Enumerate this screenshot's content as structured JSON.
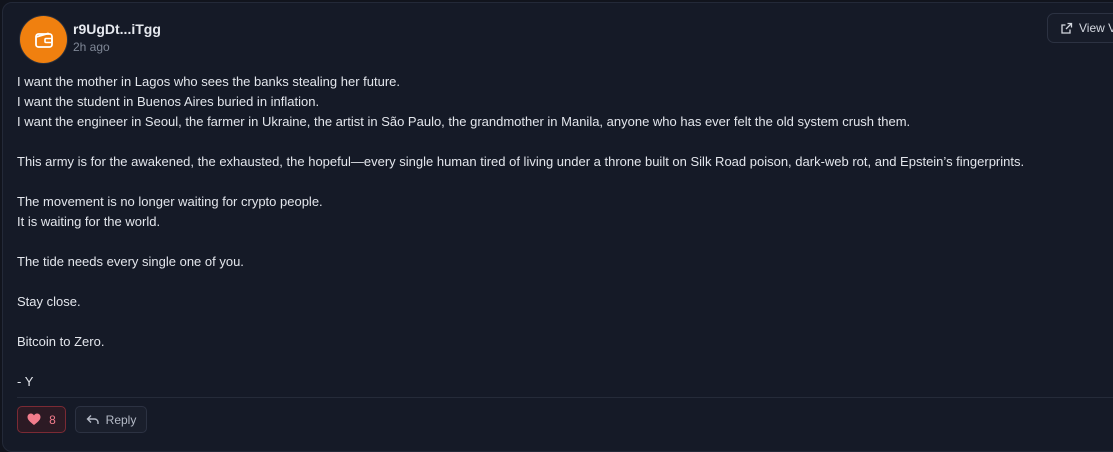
{
  "post": {
    "author": "r9UgDt...iTgg",
    "time": "2h ago",
    "view_label": "View V",
    "lines": [
      "I want the mother in Lagos who sees the banks stealing her future.",
      "I want the student in Buenos Aires buried in inflation.",
      "I want the engineer in Seoul, the farmer in Ukraine, the artist in São Paulo, the grandmother in Manila, anyone who has ever felt the old system crush them.",
      "",
      "This army is for the awakened, the exhausted, the hopeful—every single human tired of living under a throne built on Silk Road poison, dark-web rot, and Epstein’s fingerprints.",
      "",
      "The movement is no longer waiting for crypto people.",
      "It is waiting for the world.",
      "",
      "The tide needs every single one of you.",
      "",
      "Stay close.",
      "",
      "Bitcoin to Zero.",
      "",
      "- Y"
    ],
    "likes": "8",
    "reply_label": "Reply"
  },
  "colors": {
    "avatar": "#f0800f",
    "like_accent": "#f27c8c",
    "background": "#151a27"
  },
  "icons": {
    "avatar": "wallet-icon",
    "view": "external-link-icon",
    "like": "heart-icon",
    "reply": "reply-arrow-icon"
  }
}
